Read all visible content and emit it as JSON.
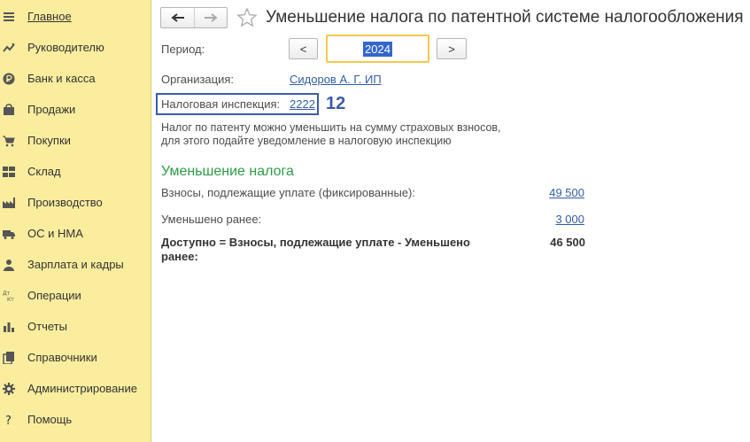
{
  "sidebar": {
    "items": [
      {
        "label": "Главное",
        "icon": "menu-lines-icon",
        "active": true
      },
      {
        "label": "Руководителю",
        "icon": "trend-chart-icon"
      },
      {
        "label": "Банк и касса",
        "icon": "ruble-coin-icon"
      },
      {
        "label": "Продажи",
        "icon": "shopping-bag-icon"
      },
      {
        "label": "Покупки",
        "icon": "shopping-cart-icon"
      },
      {
        "label": "Склад",
        "icon": "warehouse-grid-icon"
      },
      {
        "label": "Производство",
        "icon": "factory-icon"
      },
      {
        "label": "ОС и НМА",
        "icon": "truck-icon"
      },
      {
        "label": "Зарплата и кадры",
        "icon": "person-icon"
      },
      {
        "label": "Операции",
        "icon": "debit-credit-icon",
        "icon_text": [
          "Дт",
          "Кт"
        ]
      },
      {
        "label": "Отчеты",
        "icon": "bar-chart-icon"
      },
      {
        "label": "Справочники",
        "icon": "books-icon"
      },
      {
        "label": "Администрирование",
        "icon": "gear-icon"
      },
      {
        "label": "Помощь",
        "icon": "question-icon",
        "icon_text": "?"
      }
    ]
  },
  "header": {
    "title": "Уменьшение налога по патентной системе налогообложения"
  },
  "form": {
    "period_label": "Период:",
    "prev_label": "<",
    "year": "2024",
    "next_label": ">",
    "organization_label": "Организация:",
    "organization_value": "Сидоров А. Г. ИП",
    "inspection_label": "Налоговая инспекция:",
    "inspection_value": "2222",
    "annotation_number": "12",
    "note_line1": "Налог по патенту можно уменьшить на сумму страховых взносов,",
    "note_line2": "для этого подайте уведомление в налоговую инспекцию"
  },
  "reduction": {
    "section_title": "Уменьшение налога",
    "contributions_label": "Взносы, подлежащие уплате (фиксированные):",
    "contributions_value": "49 500",
    "reduced_label": "Уменьшено ранее:",
    "reduced_value": "3 000",
    "available_label_line1": "Доступно = Взносы, подлежащие уплате - Уменьшено",
    "available_label_line2": "ранее:",
    "available_value": "46 500"
  },
  "colors": {
    "sidebar_bg": "#fbed9e",
    "link": "#315ea7",
    "section_title": "#2e9b48",
    "annotation": "#3f5aa8",
    "focus_border": "#f2c94c",
    "selection": "#3366cc"
  }
}
